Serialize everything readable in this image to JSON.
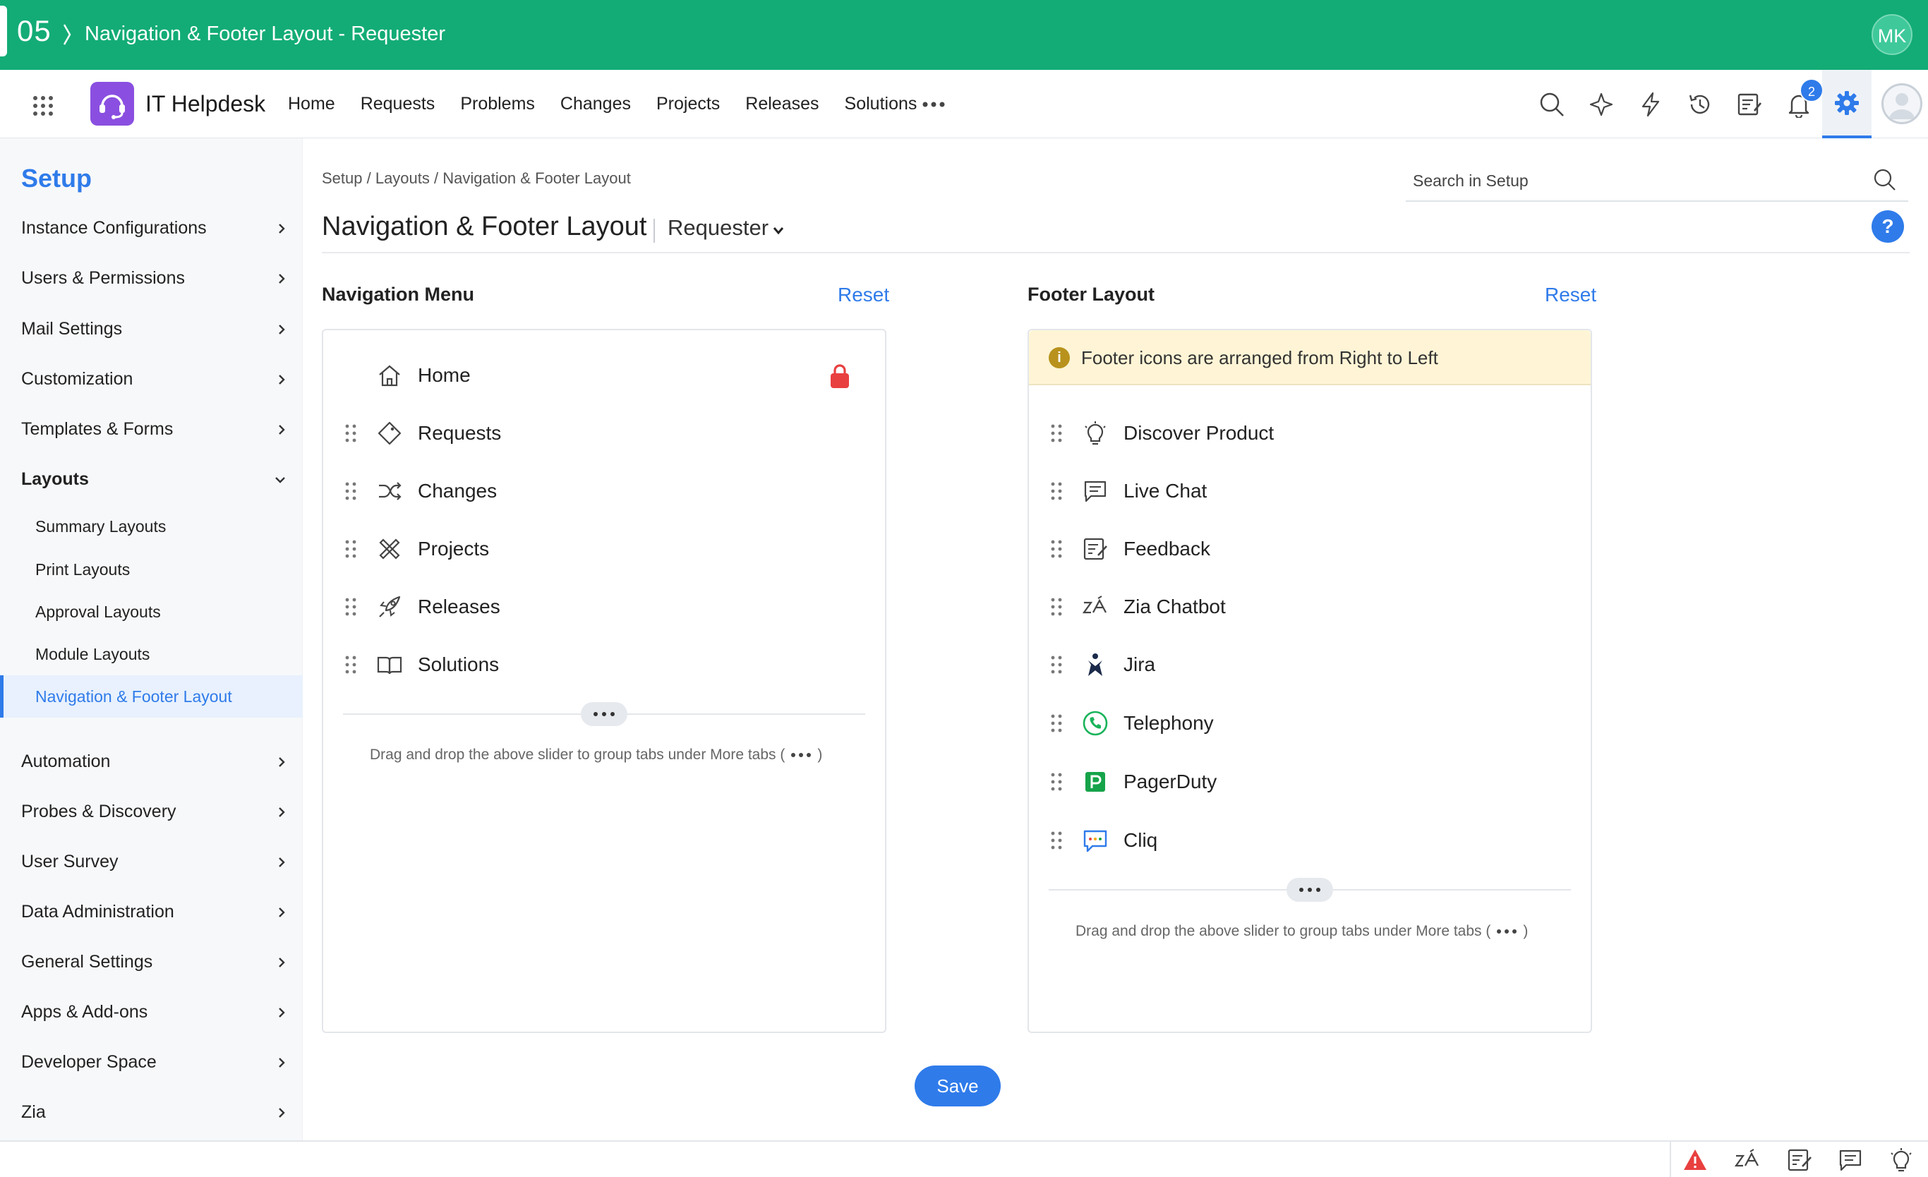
{
  "topbar": {
    "step": "05",
    "title": "Navigation & Footer Layout - Requester",
    "user_initials": "MK"
  },
  "appbar": {
    "brand": "IT Helpdesk",
    "nav": [
      "Home",
      "Requests",
      "Problems",
      "Changes",
      "Projects",
      "Releases",
      "Solutions"
    ],
    "notification_count": "2",
    "icons": [
      "search-icon",
      "ai-sparkle-icon",
      "lightning-icon",
      "history-icon",
      "notes-icon",
      "bell-icon",
      "gear-icon",
      "avatar"
    ]
  },
  "sidebar": {
    "title": "Setup",
    "items": [
      "Instance Configurations",
      "Users & Permissions",
      "Mail Settings",
      "Customization",
      "Templates & Forms",
      "Layouts"
    ],
    "layouts_sub": [
      "Summary Layouts",
      "Print Layouts",
      "Approval Layouts",
      "Module Layouts",
      "Navigation & Footer Layout"
    ],
    "items_after": [
      "Automation",
      "Probes & Discovery",
      "User Survey",
      "Data Administration",
      "General Settings",
      "Apps & Add-ons",
      "Developer Space",
      "Zia"
    ]
  },
  "main": {
    "breadcrumb": "Setup / Layouts / Navigation & Footer Layout",
    "search_placeholder": "Search in Setup",
    "title": "Navigation & Footer Layout",
    "role": "Requester",
    "help": "?"
  },
  "navigation_menu": {
    "title": "Navigation Menu",
    "reset": "Reset",
    "items": [
      "Home",
      "Requests",
      "Changes",
      "Projects",
      "Releases",
      "Solutions"
    ],
    "hint_before": "Drag and drop the above slider to group tabs under More tabs (",
    "hint_after": ")"
  },
  "footer_layout": {
    "title": "Footer Layout",
    "reset": "Reset",
    "banner": "Footer icons are arranged from Right to Left",
    "items": [
      "Discover Product",
      "Live Chat",
      "Feedback",
      "Zia Chatbot",
      "Jira",
      "Telephony",
      "PagerDuty",
      "Cliq"
    ],
    "hint_before": "Drag and drop the above slider to group tabs under More tabs (",
    "hint_after": ")"
  },
  "actions": {
    "save": "Save"
  },
  "colors": {
    "brand_green": "#13ac76",
    "accent_blue": "#2f7bea",
    "lock_red": "#e8403f",
    "banner_yellow": "#fff5d6"
  }
}
